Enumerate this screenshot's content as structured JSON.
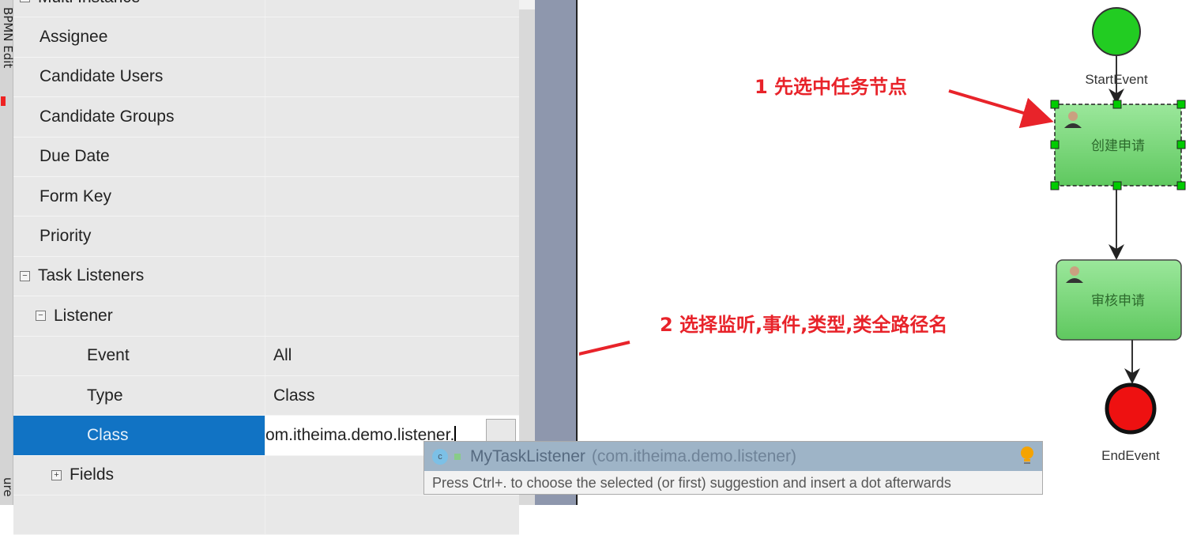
{
  "side_tabs": [
    "BPMN Edit",
    "ure"
  ],
  "properties": [
    {
      "label": "Multi Instance",
      "value": "",
      "level": 0,
      "toggle": "+"
    },
    {
      "label": "Assignee",
      "value": "",
      "level": 0
    },
    {
      "label": "Candidate Users",
      "value": "",
      "level": 0
    },
    {
      "label": "Candidate Groups",
      "value": "",
      "level": 0
    },
    {
      "label": "Due Date",
      "value": "",
      "level": 0
    },
    {
      "label": "Form Key",
      "value": "",
      "level": 0
    },
    {
      "label": "Priority",
      "value": "",
      "level": 0
    },
    {
      "label": "Task Listeners",
      "value": "",
      "level": 0,
      "toggle": "−"
    },
    {
      "label": "Listener",
      "value": "",
      "level": 1,
      "toggle": "−"
    },
    {
      "label": "Event",
      "value": "All",
      "level": 2
    },
    {
      "label": "Type",
      "value": "Class",
      "level": 2
    },
    {
      "label": "Class",
      "value": "om.itheima.demo.listener.",
      "level": 2,
      "selected": true
    },
    {
      "label": "Fields",
      "value": "",
      "level": 2,
      "toggle": "+"
    },
    {
      "label": "",
      "value": "",
      "level": 0
    }
  ],
  "browse_button": "...",
  "suggestion": {
    "name": "MyTaskListener",
    "package": "(com.itheima.demo.listener)",
    "icon": "class-icon",
    "hint": "Press Ctrl+. to choose the selected (or first) suggestion and insert a dot afterwards"
  },
  "annotations": [
    "1 先选中任务节点",
    "2 选择监听,事件,类型,类全路径名"
  ],
  "diagram": {
    "start": "StartEvent",
    "task1": "创建申请",
    "task2": "审核申请",
    "end": "EndEvent"
  },
  "colors": {
    "selection": "#1173c4",
    "annotation": "#e8232a",
    "task": "#7ed87e",
    "start": "#22cc22",
    "end": "#ee1111"
  }
}
